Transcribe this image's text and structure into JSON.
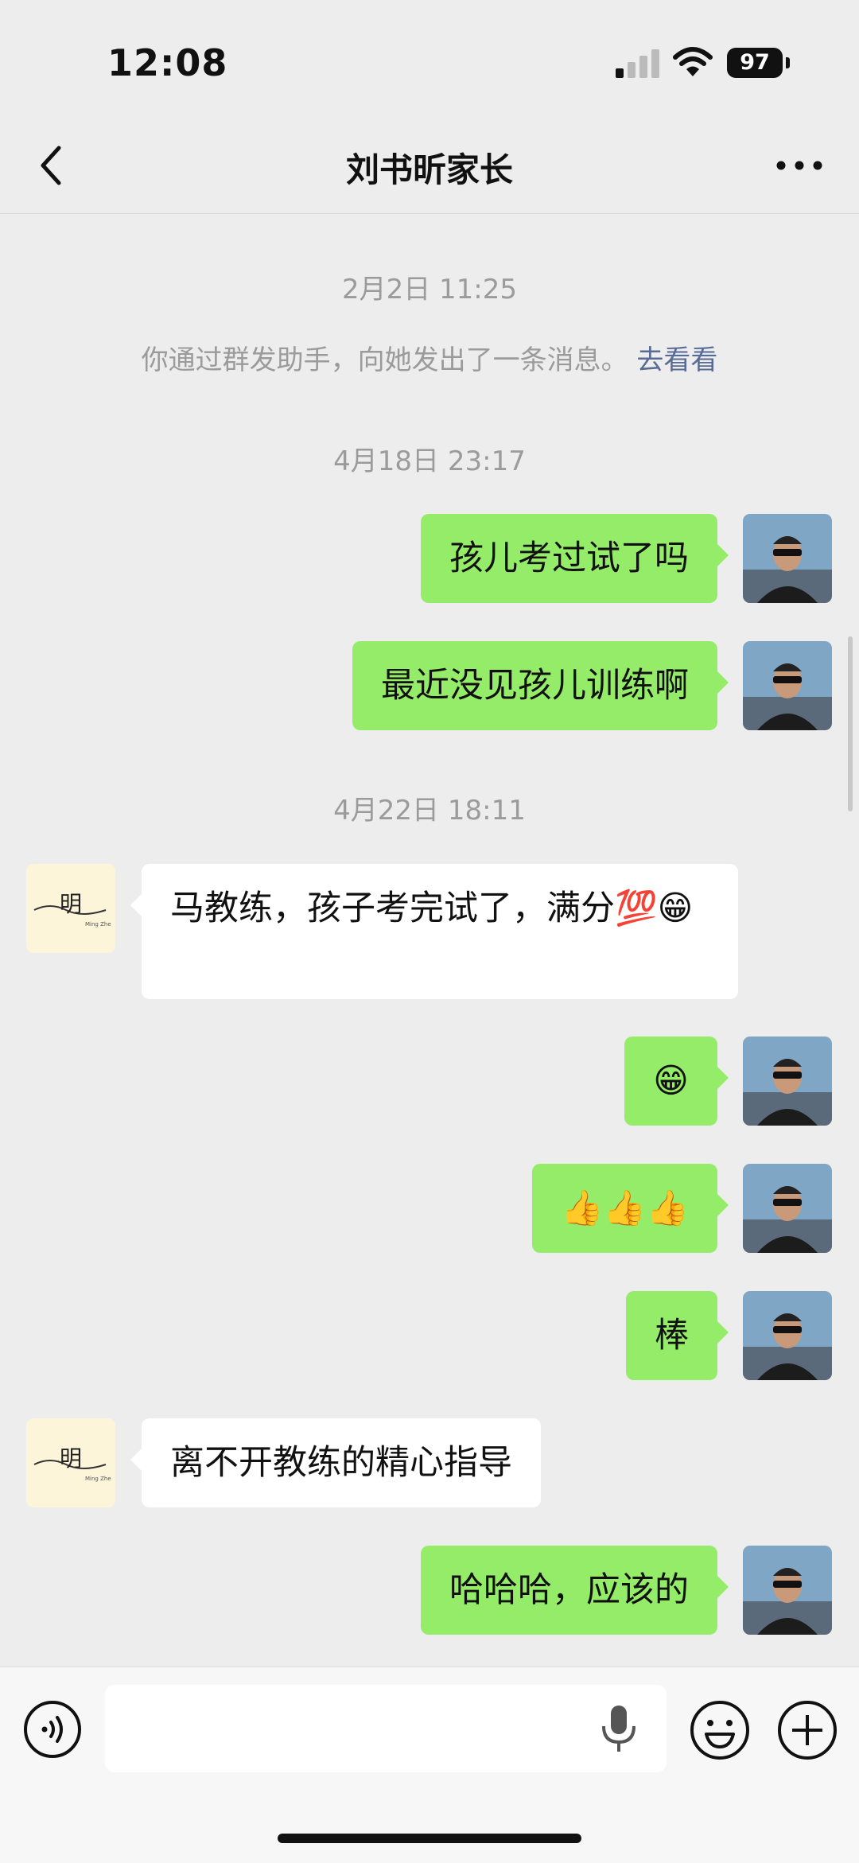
{
  "status_bar": {
    "time": "12:08",
    "battery": "97"
  },
  "nav": {
    "title": "刘书昕家长"
  },
  "timestamps": [
    "2月2日 11:25",
    "4月18日 23:17",
    "4月22日 18:11"
  ],
  "system_notice": {
    "text": "你通过群发助手，向她发出了一条消息。",
    "link": "去看看"
  },
  "messages": [
    {
      "sender": "me",
      "text": "孩儿考过试了吗"
    },
    {
      "sender": "me",
      "text": "最近没见孩儿训练啊"
    },
    {
      "sender": "them",
      "text": "马教练，孩子考完试了，满分💯😁"
    },
    {
      "sender": "me",
      "text": "😁"
    },
    {
      "sender": "me",
      "text": "👍👍👍"
    },
    {
      "sender": "me",
      "text": "棒"
    },
    {
      "sender": "them",
      "text": "离不开教练的精心指导"
    },
    {
      "sender": "me",
      "text": "哈哈哈，应该的"
    }
  ],
  "contact_avatar_text": {
    "main": "明",
    "small": "Ming Zhe"
  },
  "input": {
    "value": "",
    "placeholder": ""
  },
  "colors": {
    "my_bubble": "#95ec69",
    "their_bubble": "#ffffff",
    "background": "#ededed",
    "link": "#576b95"
  },
  "icons": [
    "back-icon",
    "more-icon",
    "voice-icon",
    "mic-icon",
    "emoji-icon",
    "plus-icon"
  ]
}
